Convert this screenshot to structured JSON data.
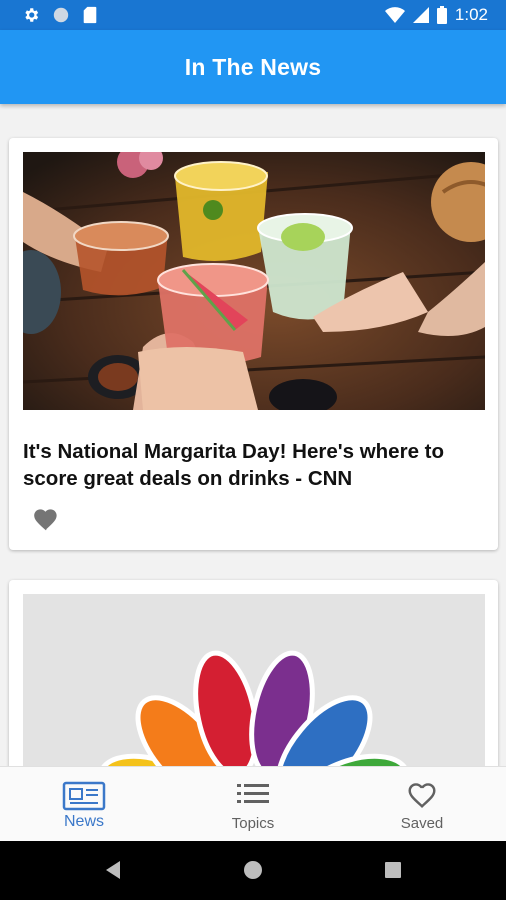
{
  "status_bar": {
    "time": "1:02",
    "icons": [
      "gear-icon",
      "circle-icon",
      "sd-card-icon",
      "wifi-icon",
      "signal-icon",
      "battery-icon"
    ]
  },
  "app_bar": {
    "title": "In The News"
  },
  "articles": [
    {
      "headline": "It's National Margarita Day! Here's where to score great deals on drinks - CNN",
      "image": "cocktails-toast-photo",
      "favorite_icon": "heart-filled-icon"
    },
    {
      "headline": "",
      "image": "nbc-peacock-logo"
    }
  ],
  "bottom_nav": {
    "items": [
      {
        "label": "News",
        "icon": "newspaper-icon",
        "active": true
      },
      {
        "label": "Topics",
        "icon": "list-icon",
        "active": false
      },
      {
        "label": "Saved",
        "icon": "heart-outline-icon",
        "active": false
      }
    ]
  },
  "colors": {
    "status_bar": "#1976d2",
    "app_bar": "#2196f3",
    "active_nav": "#3b78c9",
    "inactive_nav": "#616161"
  }
}
